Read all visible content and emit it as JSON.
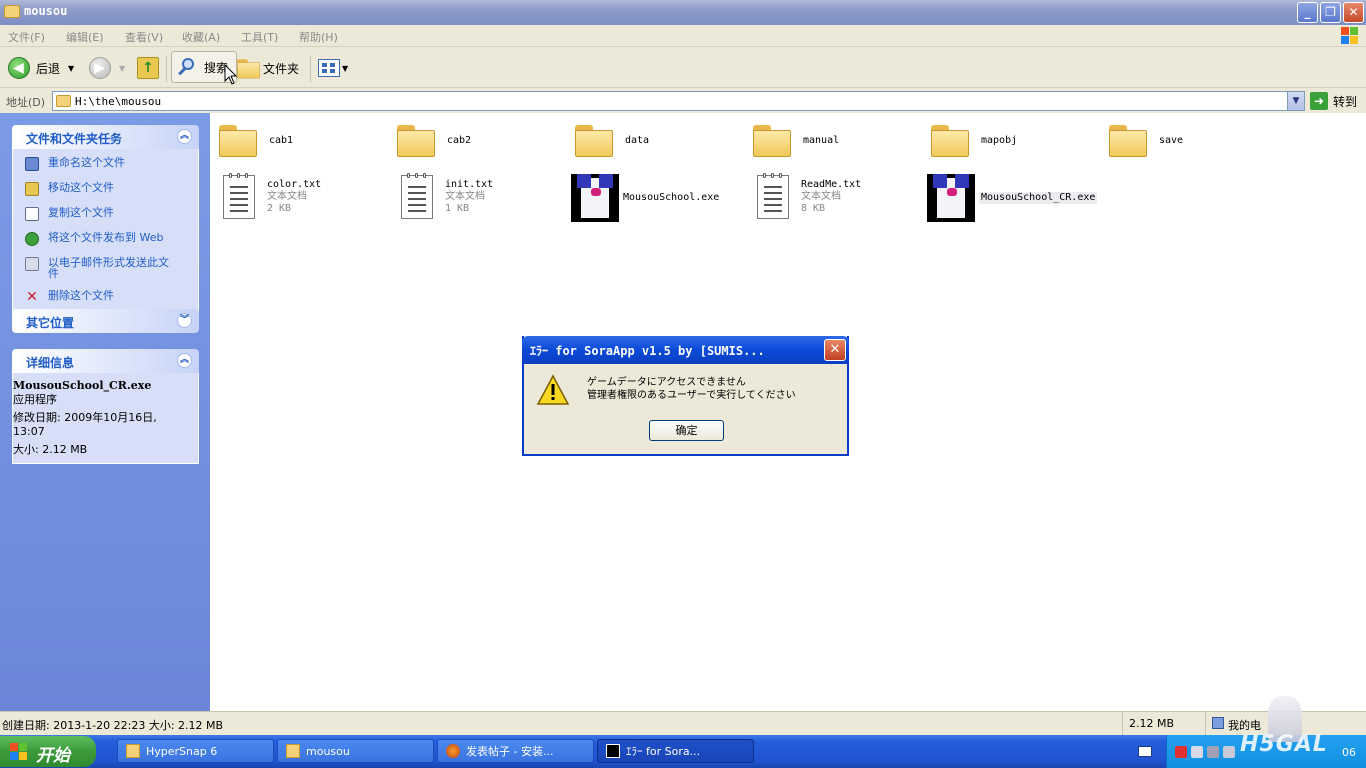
{
  "window": {
    "title": "mousou"
  },
  "menu": {
    "items": [
      "文件(F)",
      "编辑(E)",
      "查看(V)",
      "收藏(A)",
      "工具(T)",
      "帮助(H)"
    ]
  },
  "toolbar": {
    "back_label": "后退",
    "search_label": "搜索",
    "folders_label": "文件夹"
  },
  "address": {
    "label": "地址(D)",
    "value": "H:\\the\\mousou",
    "go_label": "转到"
  },
  "sidebar": {
    "tasks_title": "文件和文件夹任务",
    "tasks": [
      {
        "label": "重命名这个文件",
        "icon": "rename-icon"
      },
      {
        "label": "移动这个文件",
        "icon": "move-icon"
      },
      {
        "label": "复制这个文件",
        "icon": "copy-icon"
      },
      {
        "label": "将这个文件发布到 Web",
        "icon": "web-publish-icon"
      },
      {
        "label": "以电子邮件形式发送此文件",
        "icon": "email-icon"
      },
      {
        "label": "删除这个文件",
        "icon": "delete-icon"
      }
    ],
    "other_title": "其它位置",
    "details_title": "详细信息",
    "details": {
      "name": "MousouSchool_CR.exe",
      "type": "应用程序",
      "modified": "修改日期: 2009年10月16日, 13:07",
      "size": "大小: 2.12 MB"
    }
  },
  "files": {
    "folders": [
      "cab1",
      "cab2",
      "data",
      "manual",
      "mapobj",
      "save"
    ],
    "items": [
      {
        "name": "color.txt",
        "type": "文本文档",
        "size": "2 KB"
      },
      {
        "name": "init.txt",
        "type": "文本文档",
        "size": "1 KB"
      },
      {
        "name": "MousouSchool.exe"
      },
      {
        "name": "ReadMe.txt",
        "type": "文本文档",
        "size": "8 KB"
      },
      {
        "name": "MousouSchool_CR.exe"
      }
    ]
  },
  "dialog": {
    "title": "ｴﾗｰ  for SoraApp v1.5 by [SUMIS...",
    "message_line1": "ゲームデータにアクセスできません",
    "message_line2": "管理者権限のあるユーザーで実行してください",
    "ok_label": "确定"
  },
  "status": {
    "info": "创建日期: 2013-1-20 22:23 大小: 2.12 MB",
    "size": "2.12 MB",
    "location": "我的电"
  },
  "taskbar": {
    "start_label": "开始",
    "tasks": [
      "HyperSnap 6",
      "mousou",
      "发表帖子 - 安装...",
      "ｴﾗｰ  for Sora..."
    ],
    "clock_fragment": "06"
  },
  "watermark": "H5GAL",
  "colors": {
    "sidebar_bg": "#6b86d8",
    "dialog_title": "#0b4ad8",
    "taskbar": "#245edb",
    "start": "#3c9a3c"
  }
}
